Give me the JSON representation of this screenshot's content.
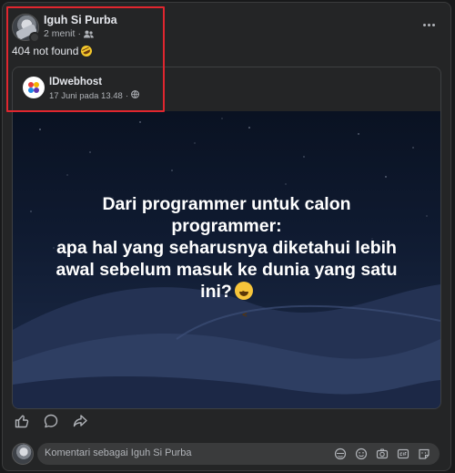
{
  "post": {
    "author": "Iguh Si Purba",
    "time": "2 menit",
    "separator": "·",
    "text": "404 not found"
  },
  "shared": {
    "page_name": "IDwebhost",
    "date": "17 Juni pada 13.48",
    "separator": "·",
    "caption_lines": [
      "Dari programmer untuk calon",
      "programmer:",
      "apa hal yang seharusnya diketahui lebih",
      "awal sebelum masuk ke dunia yang satu",
      "ini?"
    ]
  },
  "comment": {
    "placeholder": "Komentari sebagai Iguh Si Purba"
  },
  "icons": {
    "audience": "friends-icon",
    "page_audience": "globe-icon",
    "actions": [
      "like-icon",
      "comment-icon",
      "share-icon"
    ],
    "composer": [
      "avatar-sticker-icon",
      "emoji-icon",
      "camera-icon",
      "gif-icon",
      "sticker-icon"
    ]
  },
  "colors": {
    "background": "#18191a",
    "card": "#242526",
    "highlight": "#e0262f",
    "text_primary": "#e4e6eb",
    "text_secondary": "#b0b3b8"
  }
}
